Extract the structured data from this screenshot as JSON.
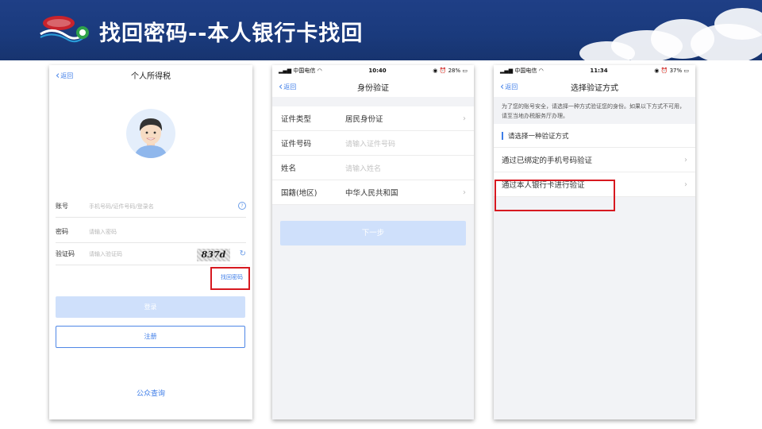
{
  "slide": {
    "title": "找回密码--本人银行卡找回",
    "colors": {
      "banner": "#1f3f86",
      "accent": "#3f7ee8",
      "highlight": "#d71920",
      "disabled_button": "#cfe0fb"
    }
  },
  "phone1": {
    "back_label": "返回",
    "nav_title": "个人所得税",
    "account_label": "账号",
    "account_placeholder": "手机号码/证件号码/登录名",
    "password_label": "密码",
    "password_placeholder": "请输入密码",
    "captcha_label": "验证码",
    "captcha_placeholder": "请输入验证码",
    "captcha_text": "837d",
    "find_password_link": "找回密码",
    "login_button": "登录",
    "register_button": "注册",
    "public_query": "公众查询",
    "icons": [
      "back-chevron-icon",
      "help-icon",
      "refresh-icon",
      "avatar"
    ]
  },
  "phone2": {
    "status": {
      "carrier": "中国电信",
      "time": "10:40",
      "battery": "28%"
    },
    "back_label": "返回",
    "nav_title": "身份验证",
    "rows": [
      {
        "label": "证件类型",
        "value": "居民身份证",
        "placeholder": ""
      },
      {
        "label": "证件号码",
        "value": "",
        "placeholder": "请输入证件号码"
      },
      {
        "label": "姓名",
        "value": "",
        "placeholder": "请输入姓名"
      },
      {
        "label": "国籍(地区)",
        "value": "中华人民共和国",
        "placeholder": ""
      }
    ],
    "next_button": "下一步"
  },
  "phone3": {
    "status": {
      "carrier": "中国电信",
      "time": "11:34",
      "battery": "37%"
    },
    "back_label": "返回",
    "nav_title": "选择验证方式",
    "tip": "为了您的账号安全，请选择一种方式验证您的身份。如果以下方式不可用，请至当地办税服务厅办理。",
    "section_title": "请选择一种验证方式",
    "options": [
      {
        "label": "通过已绑定的手机号码验证"
      },
      {
        "label": "通过本人银行卡进行验证"
      }
    ]
  }
}
